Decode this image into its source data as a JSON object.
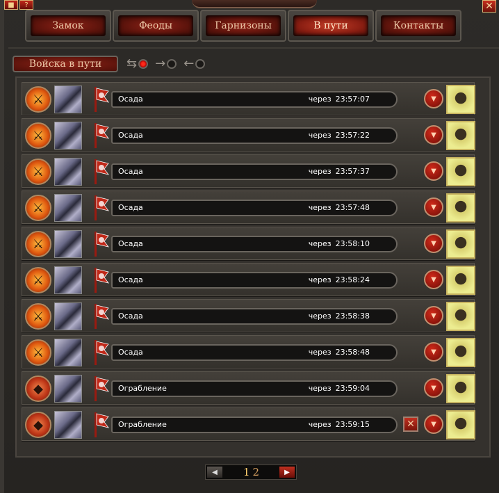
{
  "tabs": [
    {
      "label": "Замок"
    },
    {
      "label": "Феоды"
    },
    {
      "label": "Гарнизоны"
    },
    {
      "label": "В пути"
    },
    {
      "label": "Контакты"
    }
  ],
  "subtab_label": "Войска в пути",
  "top": {
    "lock_icon": "lock-icon",
    "help_label": "?",
    "close_label": "✕"
  },
  "rows": [
    {
      "action": "Осада",
      "prefix": "через",
      "time": "23:57:07",
      "kind": "siege",
      "cancel": false
    },
    {
      "action": "Осада",
      "prefix": "через",
      "time": "23:57:22",
      "kind": "siege",
      "cancel": false
    },
    {
      "action": "Осада",
      "prefix": "через",
      "time": "23:57:37",
      "kind": "siege",
      "cancel": false
    },
    {
      "action": "Осада",
      "prefix": "через",
      "time": "23:57:48",
      "kind": "siege",
      "cancel": false
    },
    {
      "action": "Осада",
      "prefix": "через",
      "time": "23:58:10",
      "kind": "siege",
      "cancel": false
    },
    {
      "action": "Осада",
      "prefix": "через",
      "time": "23:58:24",
      "kind": "siege",
      "cancel": false
    },
    {
      "action": "Осада",
      "prefix": "через",
      "time": "23:58:38",
      "kind": "siege",
      "cancel": false
    },
    {
      "action": "Осада",
      "prefix": "через",
      "time": "23:58:48",
      "kind": "siege",
      "cancel": false
    },
    {
      "action": "Ограбление",
      "prefix": "через",
      "time": "23:59:04",
      "kind": "robbery",
      "cancel": false
    },
    {
      "action": "Ограбление",
      "prefix": "через",
      "time": "23:59:15",
      "kind": "robbery",
      "cancel": true
    }
  ],
  "pager": {
    "current": "1",
    "other": "2"
  }
}
